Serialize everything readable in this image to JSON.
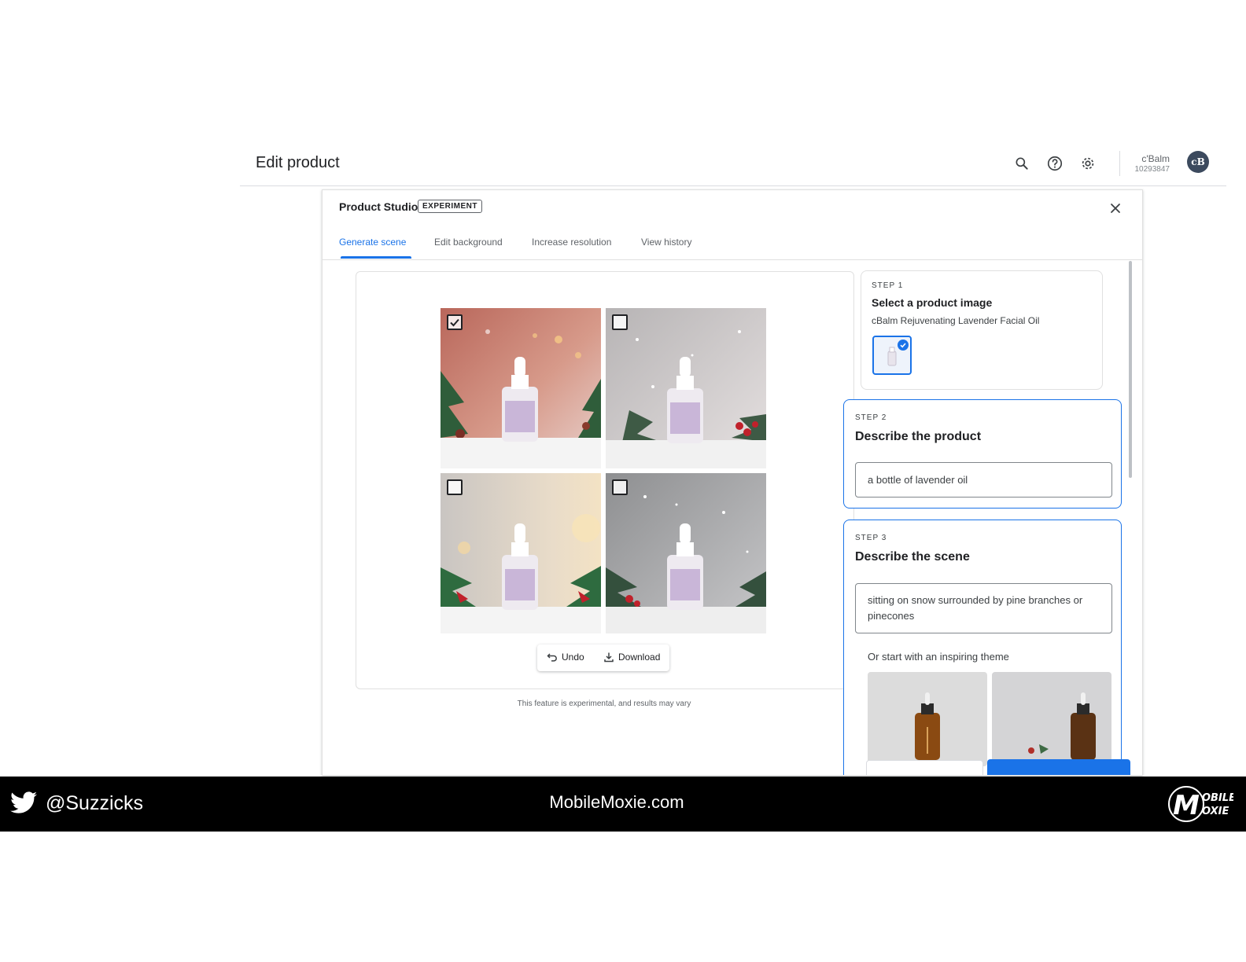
{
  "header": {
    "title": "Edit product",
    "icons": [
      "search-icon",
      "help-icon",
      "settings-icon"
    ],
    "account_name": "c'Balm",
    "account_id": "10293847",
    "avatar_initials": "cB"
  },
  "dialog": {
    "title": "Product Studio",
    "badge": "EXPERIMENT",
    "tabs": [
      {
        "label": "Generate scene",
        "active": true
      },
      {
        "label": "Edit background",
        "active": false
      },
      {
        "label": "Increase resolution",
        "active": false
      },
      {
        "label": "View history",
        "active": false
      }
    ],
    "images": [
      {
        "checked": true
      },
      {
        "checked": false
      },
      {
        "checked": false
      },
      {
        "checked": false
      }
    ],
    "actions": {
      "undo": "Undo",
      "download": "Download"
    },
    "disclaimer": "This feature is experimental, and results may vary",
    "step1": {
      "label": "STEP 1",
      "title": "Select a product image",
      "product": "cBalm Rejuvenating Lavender Facial Oil"
    },
    "step2": {
      "label": "STEP 2",
      "title": "Describe the product",
      "value": "a bottle of lavender oil"
    },
    "step3": {
      "label": "STEP 3",
      "title": "Describe the scene",
      "value": "sitting on snow surrounded by pine branches or pinecones",
      "theme_prompt": "Or start with an inspiring theme"
    }
  },
  "footer": {
    "handle": "@Suzzicks",
    "site": "MobileMoxie.com",
    "logo_text_1": "OBILE",
    "logo_text_2": "OXIE",
    "logo_letter": "M"
  },
  "colors": {
    "accent": "#1a73e8",
    "footer_bg": "#000000",
    "avatar_bg": "#3c4a5e"
  }
}
